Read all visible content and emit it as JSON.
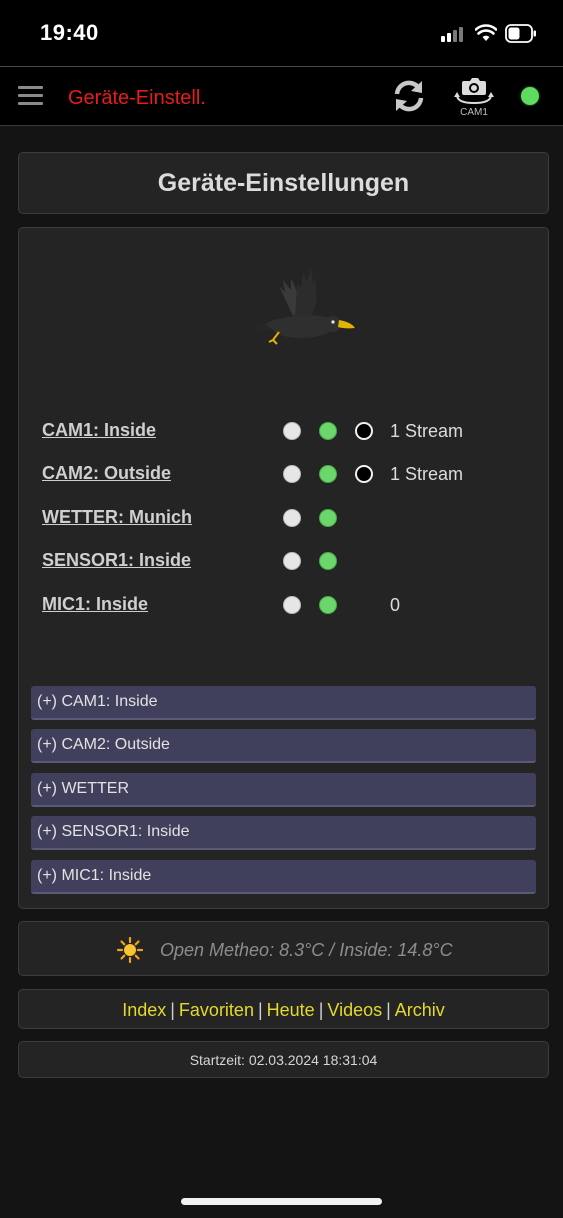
{
  "status_bar": {
    "time": "19:40"
  },
  "header": {
    "title": "Geräte-Einstell.",
    "camera_label": "CAM1",
    "reload_icon": "reload-icon",
    "camera_icon": "camera-switch-icon",
    "status_color": "#5fdc5f",
    "title_color": "#e81c1c"
  },
  "page": {
    "title": "Geräte-Einstellungen"
  },
  "devices": [
    {
      "name": "CAM1: Inside",
      "info": "1 Stream"
    },
    {
      "name": "CAM2: Outside",
      "info": "1 Stream"
    },
    {
      "name": "WETTER: Munich",
      "info": ""
    },
    {
      "name": "SENSOR1: Inside",
      "info": ""
    },
    {
      "name": "MIC1: Inside",
      "info": "0"
    }
  ],
  "sections": [
    "(+) CAM1: Inside",
    "(+) CAM2: Outside",
    "(+) WETTER",
    "(+) SENSOR1: Inside",
    "(+) MIC1: Inside"
  ],
  "weather": {
    "text": "Open Metheo: 8.3°C / Inside: 14.8°C",
    "icon": "sun-icon"
  },
  "links": [
    "Index",
    "Favoriten",
    "Heute",
    "Videos",
    "Archiv"
  ],
  "link_separator": "|",
  "startzeit": "Startzeit: 02.03.2024 18:31:04",
  "colors": {
    "accent_link": "#e4d92b",
    "accordion_bg": "#40405c",
    "background": "#141414"
  }
}
